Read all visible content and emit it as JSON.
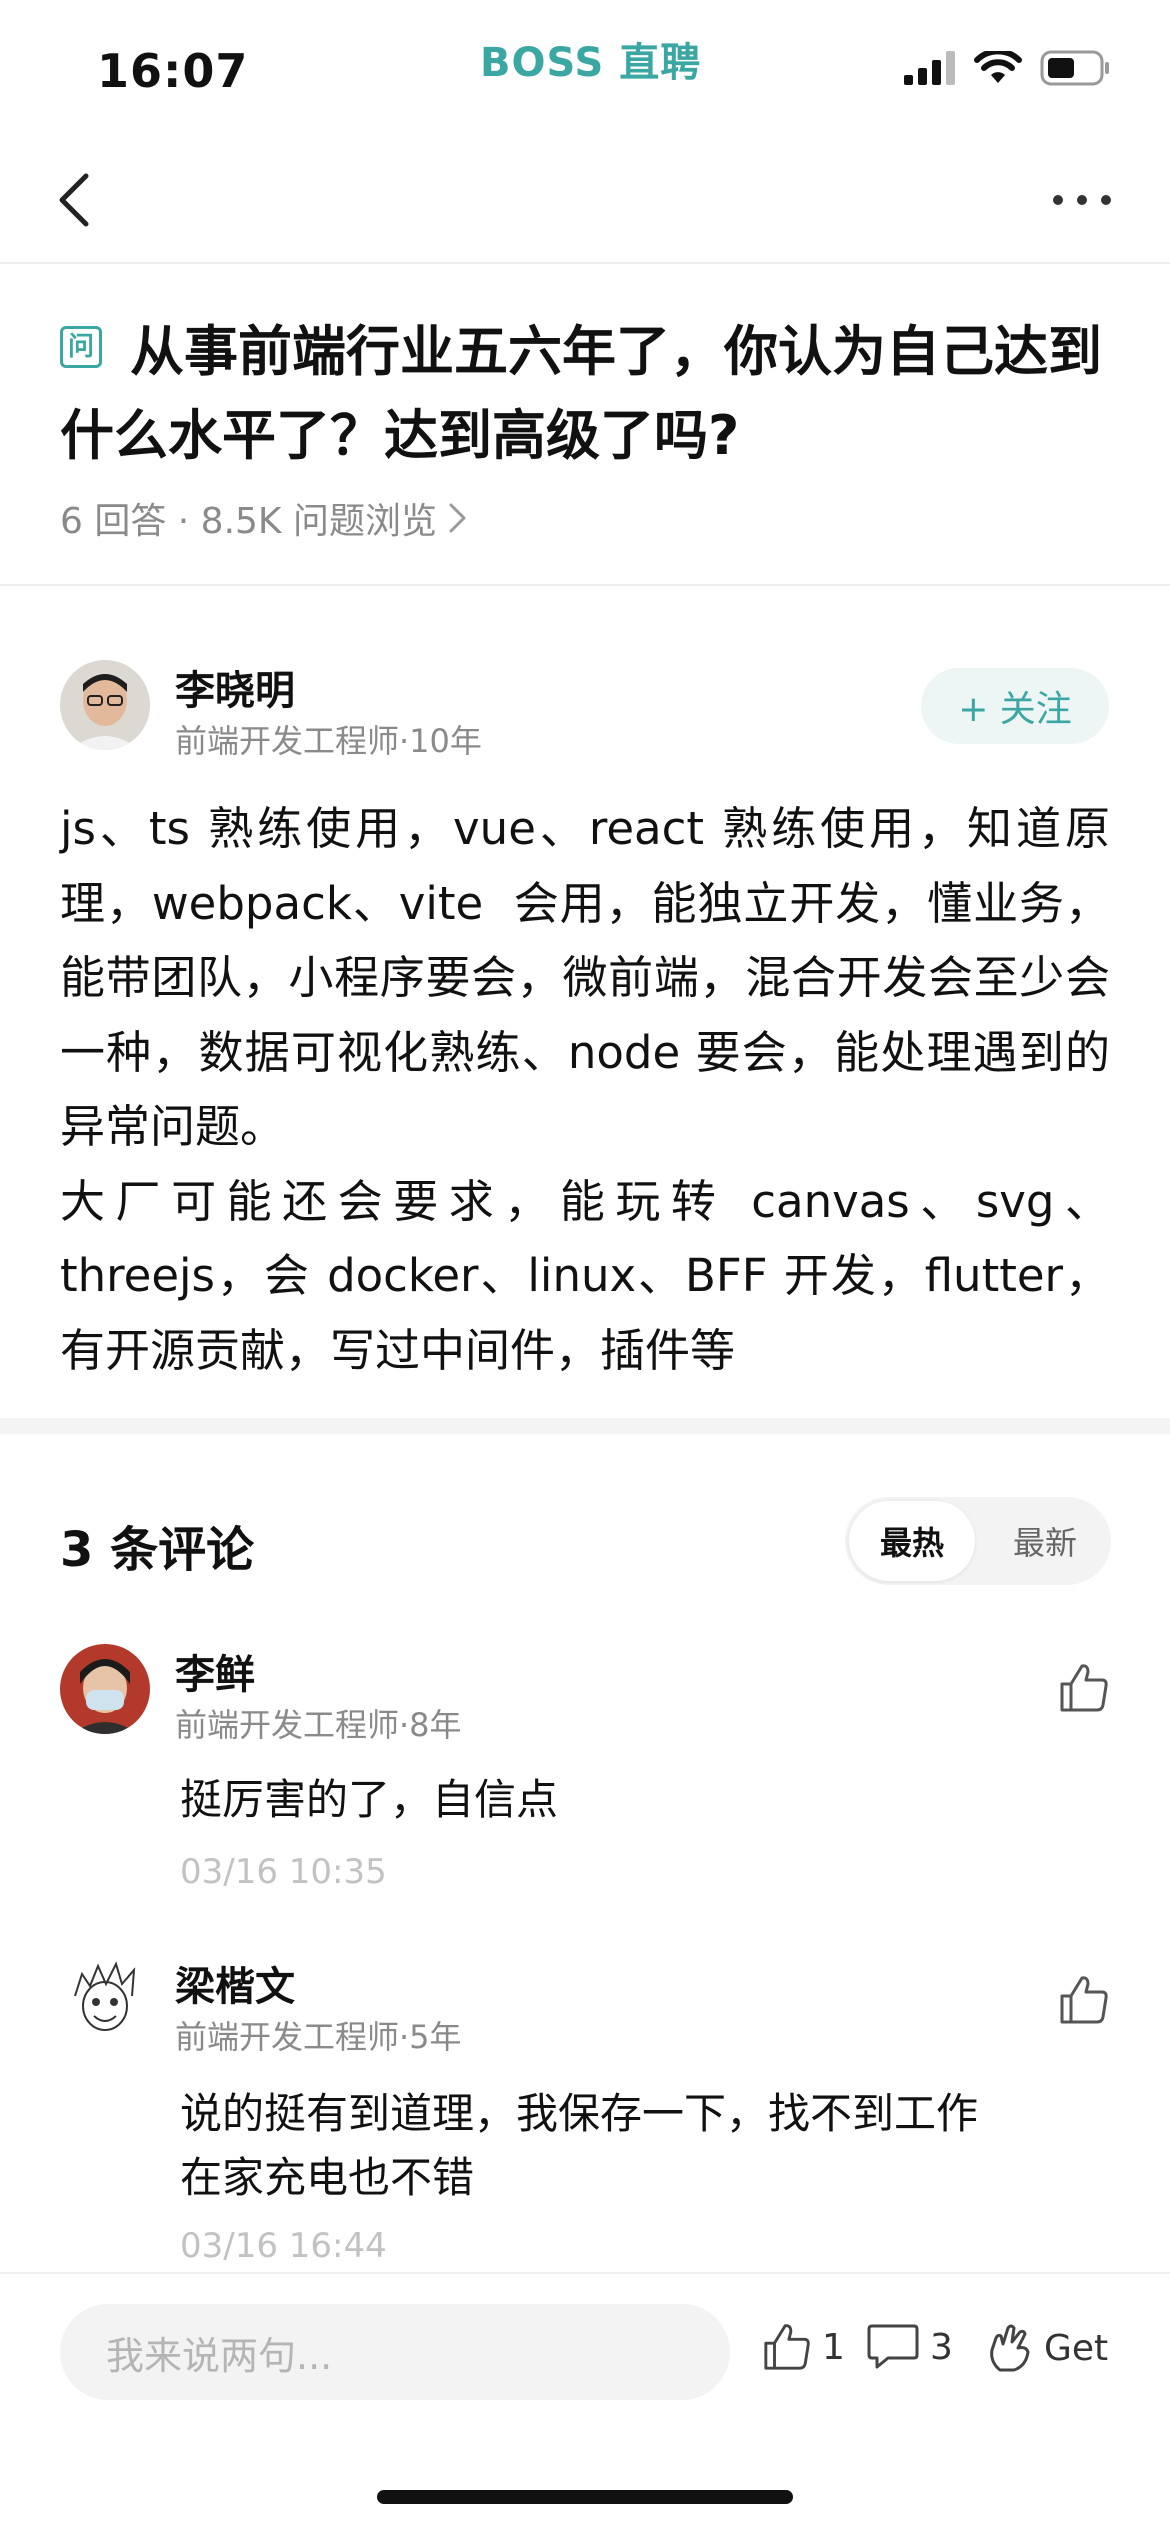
{
  "status_bar": {
    "time": "16:07",
    "brand": "BOSS 直聘"
  },
  "nav": {
    "back_icon": "chevron-left-icon",
    "more_icon": "more-horizontal-icon"
  },
  "question": {
    "badge": "问",
    "title": "从事前端行业五六年了，你认为自己达到什么水平了？达到高级了吗?",
    "meta": "6 回答 · 8.5K 问题浏览"
  },
  "answer": {
    "author_name": "李晓明",
    "author_sub": "前端开发工程师·10年",
    "follow_label": "+ 关注",
    "body": "js、ts 熟练使用，vue、react 熟练使用，知道原理，webpack、vite  会用，能独立开发，懂业务，能带团队，小程序要会，微前端，混合开发会至少会一种，数据可视化熟练、node 要会，能处理遇到的异常问题。\n大厂可能还会要求，能玩转 canvas、svg、threejs，会 docker、linux、BFF 开发，flutter，有开源贡献，写过中间件，插件等"
  },
  "comments": {
    "count_label": "3 条评论",
    "sort_hot": "最热",
    "sort_new": "最新",
    "items": [
      {
        "name": "李鲜",
        "sub": "前端开发工程师·8年",
        "text": "挺厉害的了，自信点",
        "time": "03/16 10:35"
      },
      {
        "name": "梁楷文",
        "sub": "前端开发工程师·5年",
        "text": "说的挺有到道理，我保存一下，找不到工作在家充电也不错",
        "time": "03/16 16:44"
      }
    ]
  },
  "bottom_bar": {
    "input_placeholder": "我来说两句...",
    "like_count": "1",
    "comment_count": "3",
    "get_label": "Get"
  },
  "colors": {
    "accent": "#3aa7a2",
    "text": "#111111",
    "muted": "#8a8a8a"
  }
}
